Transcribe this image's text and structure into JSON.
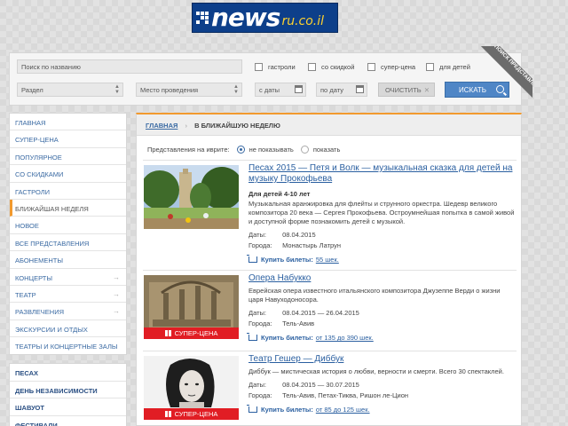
{
  "logo": {
    "brand": "news",
    "domain": "ru.co.il"
  },
  "search": {
    "name_placeholder": "Поиск по названию",
    "section_label": "Раздел",
    "venue_label": "Место проведения",
    "date_from_label": "с даты",
    "date_to_label": "по дату",
    "clear_label": "ОЧИСТИТЬ",
    "search_label": "ИСКАТЬ",
    "checkboxes": [
      "гастроли",
      "со скидкой",
      "супер-цена",
      "для детей"
    ],
    "ribbon_text": "ПОИСК ПРЕДСТАВЛЕНИЯ"
  },
  "sidebar": {
    "groups": [
      {
        "items": [
          {
            "label": "ГЛАВНАЯ"
          },
          {
            "label": "СУПЕР-ЦЕНА"
          },
          {
            "label": "ПОПУЛЯРНОЕ"
          },
          {
            "label": "СО СКИДКАМИ"
          },
          {
            "label": "ГАСТРОЛИ"
          },
          {
            "label": "БЛИЖАЙШАЯ НЕДЕЛЯ"
          },
          {
            "label": "НОВОЕ"
          },
          {
            "label": "ВСЕ ПРЕДСТАВЛЕНИЯ"
          },
          {
            "label": "АБОНЕМЕНТЫ"
          },
          {
            "label": "КОНЦЕРТЫ"
          },
          {
            "label": "ТЕАТР"
          },
          {
            "label": "РАЗВЛЕЧЕНИЯ"
          },
          {
            "label": "ЭКСКУРСИИ И ОТДЫХ"
          },
          {
            "label": "ТЕАТРЫ И КОНЦЕРТНЫЕ ЗАЛЫ"
          }
        ]
      },
      {
        "items": [
          {
            "label": "ПЕСАХ"
          },
          {
            "label": "ДЕНЬ НЕЗАВИСИМОСТИ"
          },
          {
            "label": "ШАВУОТ"
          },
          {
            "label": "ФЕСТИВАЛИ"
          }
        ]
      }
    ],
    "active_index": 5
  },
  "breadcrumb": {
    "home": "ГЛАВНАЯ",
    "separator": "›",
    "current": "В БЛИЖАЙШУЮ НЕДЕЛЮ"
  },
  "hebrew": {
    "label": "Представления на иврите:",
    "opt_hide": "не показывать",
    "opt_show": "показать",
    "selected": "не показывать"
  },
  "events": [
    {
      "title": "Песах 2015 — Петя и Волк — музыкальная сказка для детей на музыку Прокофьева",
      "subtitle": "Для детей 4-10 лет",
      "description": "Музыкальная аранжировка для флейты и струнного оркестра. Шедевр великого композитора 20 века — Сергея Прокофьева. Остроумнейшая попытка в самой живой и доступной форме познакомить детей с музыкой.",
      "dates_label": "Даты:",
      "dates": "08.04.2015",
      "cities_label": "Города:",
      "cities": "Монастырь Латрун",
      "buy_label": "Купить билеты:",
      "price": "55 шек.",
      "badge": ""
    },
    {
      "title": "Опера Набукко",
      "subtitle": "",
      "description": "Еврейская опера известного итальянского композитора Джузеппе Верди о жизни царя Навуходоносора.",
      "dates_label": "Даты:",
      "dates": "08.04.2015 — 26.04.2015",
      "cities_label": "Города:",
      "cities": "Тель-Авив",
      "buy_label": "Купить билеты:",
      "price": "от 135 до 390 шек.",
      "badge": "СУПЕР-ЦЕНА"
    },
    {
      "title": "Театр Гешер — Диббук",
      "subtitle": "",
      "description": "Диббук — мистическая история о любви, верности и смерти. Всего 30 спектаклей.",
      "dates_label": "Даты:",
      "dates": "08.04.2015 — 30.07.2015",
      "cities_label": "Города:",
      "cities": "Тель-Авив, Петах-Тиква, Ришон ле-Цион",
      "buy_label": "Купить билеты:",
      "price": "от 85 до 125 шек.",
      "badge": "СУПЕР-ЦЕНА"
    }
  ],
  "colors": {
    "accent": "#f29a2e",
    "link": "#2a5fa0",
    "badge": "#e11d24",
    "search_button": "#4f86c6",
    "logo_bg": "#0d3f8a"
  }
}
